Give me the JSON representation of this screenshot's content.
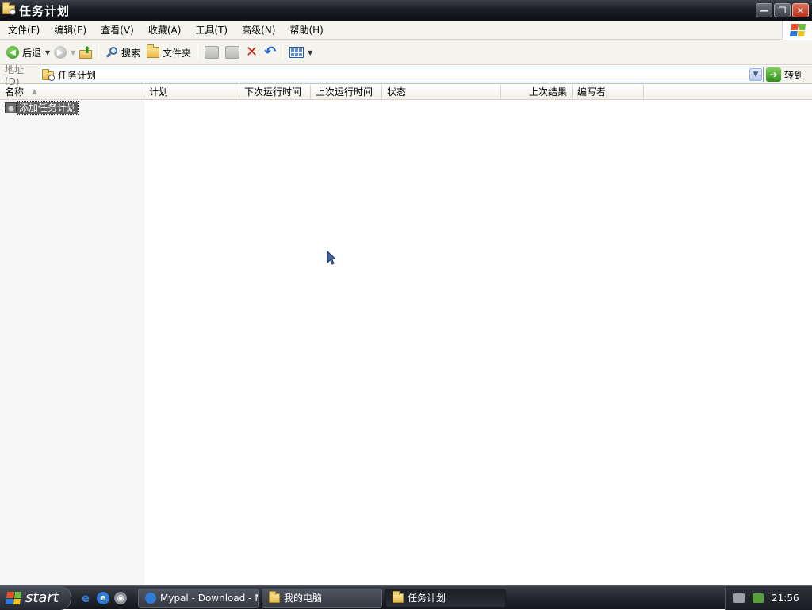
{
  "window": {
    "title": "任务计划",
    "buttons": {
      "minimize": "—",
      "restore": "❐",
      "close": "✕"
    }
  },
  "menu": [
    "文件(F)",
    "编辑(E)",
    "查看(V)",
    "收藏(A)",
    "工具(T)",
    "高级(N)",
    "帮助(H)"
  ],
  "toolbar": {
    "back_label": "后退",
    "search_label": "搜索",
    "folders_label": "文件夹"
  },
  "address": {
    "label": "地址(D)",
    "value": "任务计划",
    "go_label": "转到"
  },
  "columns": [
    {
      "label": "名称",
      "sorted": "ascending"
    },
    {
      "label": "计划"
    },
    {
      "label": "下次运行时间"
    },
    {
      "label": "上次运行时间"
    },
    {
      "label": "状态"
    },
    {
      "label": "上次结果"
    },
    {
      "label": "编写者"
    }
  ],
  "items": [
    {
      "label": "添加任务计划",
      "selected": true
    }
  ],
  "taskbar": {
    "start_label": "start",
    "tasks": [
      {
        "label": "Mypal - Download - Mi...",
        "active": false
      },
      {
        "label": "我的电脑",
        "active": false
      },
      {
        "label": "任务计划",
        "active": true
      }
    ],
    "clock": "21:56"
  }
}
